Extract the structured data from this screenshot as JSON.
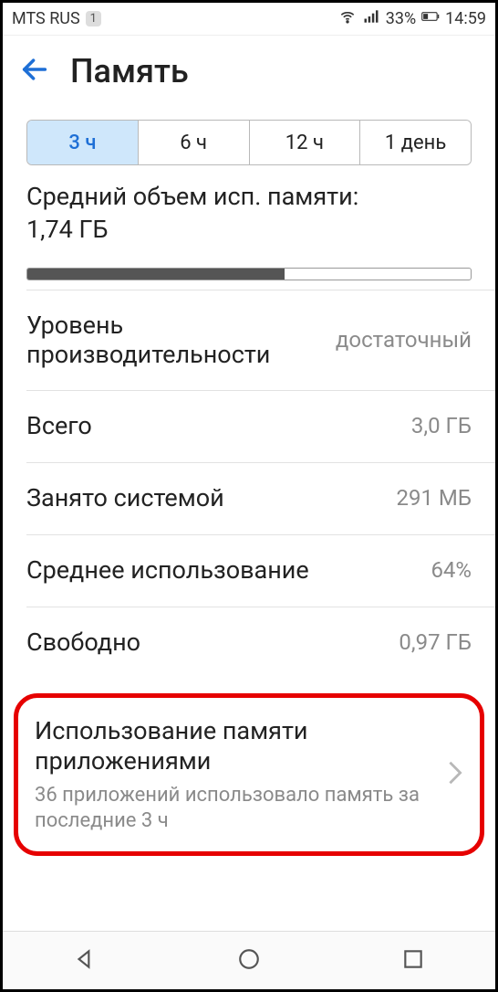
{
  "status": {
    "carrier": "MTS RUS",
    "sim": "1",
    "battery_pct": "33%",
    "time": "14:59"
  },
  "header": {
    "title": "Память"
  },
  "segments": [
    "3 ч",
    "6 ч",
    "12 ч",
    "1 день"
  ],
  "avg": {
    "label": "Средний объем исп. памяти:",
    "value": "1,74 ГБ"
  },
  "rows": {
    "perf": {
      "label": "Уровень производительности",
      "value": "достаточный"
    },
    "total": {
      "label": "Всего",
      "value": "3,0 ГБ"
    },
    "system": {
      "label": "Занято системой",
      "value": "291 МБ"
    },
    "avguse": {
      "label": "Среднее использование",
      "value": "64%"
    },
    "free": {
      "label": "Свободно",
      "value": "0,97 ГБ"
    }
  },
  "apps": {
    "title": "Использование памяти приложениями",
    "sub": "36 приложений использовало память за последние 3 ч"
  }
}
